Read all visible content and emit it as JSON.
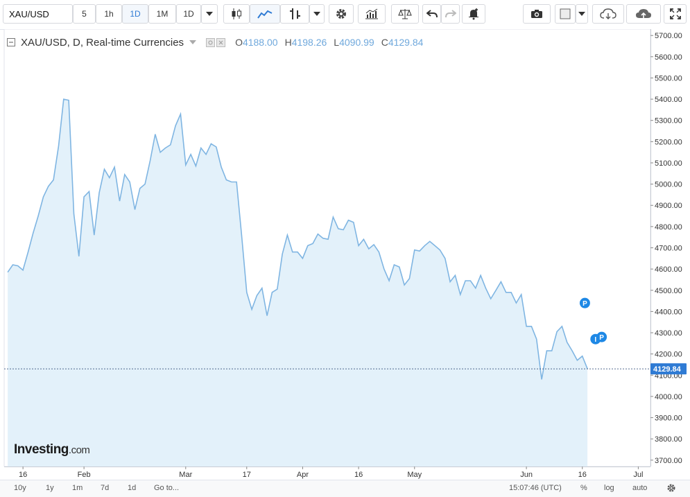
{
  "toolbar": {
    "symbol": "XAU/USD",
    "intervals": [
      "5",
      "1h",
      "1D",
      "1M",
      "1D"
    ],
    "active_interval_index": 2
  },
  "legend": {
    "title": "XAU/USD, D, Real-time Currencies",
    "o_label": "O",
    "o_value": "4188.00",
    "h_label": "H",
    "h_value": "4198.26",
    "l_label": "L",
    "l_value": "4090.99",
    "c_label": "C",
    "c_value": "4129.84"
  },
  "branding": {
    "name": "Investing",
    "domain": ".com"
  },
  "bottom_bar": {
    "ranges": [
      "10y",
      "1y",
      "1m",
      "7d",
      "1d"
    ],
    "goto": "Go to...",
    "time": "15:07:46 (UTC)",
    "percent": "%",
    "log": "log",
    "auto": "auto"
  },
  "colors": {
    "line": "#7fb5e2",
    "fill": "#e3f1fa",
    "price_tag": "#2f7bd4",
    "marker": "#1e88e5"
  },
  "chart_data": {
    "type": "area",
    "title": "XAU/USD, D, Real-time Currencies",
    "current_price": "4129.84",
    "y_ticks": [
      "3700.00",
      "3800.00",
      "3900.00",
      "4000.00",
      "4100.00",
      "4200.00",
      "4300.00",
      "4400.00",
      "4500.00",
      "4600.00",
      "4700.00",
      "4800.00",
      "4900.00",
      "5000.00",
      "5100.00",
      "5200.00",
      "5300.00",
      "5400.00",
      "5500.00",
      "5600.00",
      "5700.00"
    ],
    "ylim": [
      3670,
      5730
    ],
    "x_ticks": [
      {
        "label": "16",
        "t": 3
      },
      {
        "label": "Feb",
        "t": 15
      },
      {
        "label": "Mar",
        "t": 35
      },
      {
        "label": "17",
        "t": 47
      },
      {
        "label": "Apr",
        "t": 58
      },
      {
        "label": "16",
        "t": 69
      },
      {
        "label": "May",
        "t": 80
      },
      {
        "label": "Jun",
        "t": 102
      },
      {
        "label": "16",
        "t": 113
      },
      {
        "label": "Jul",
        "t": 124
      }
    ],
    "xlim": [
      -0.7,
      126.4
    ],
    "markers": [
      {
        "label": "P",
        "t": 113.5,
        "y": 4440
      },
      {
        "label": "I",
        "t": 115.6,
        "y": 4270
      },
      {
        "label": "P",
        "t": 116.8,
        "y": 4280
      }
    ],
    "series": [
      {
        "values": [
          4585,
          4620,
          4615,
          4595,
          4680,
          4770,
          4850,
          4940,
          4990,
          5020,
          5180,
          5400,
          5395,
          4860,
          4660,
          4940,
          4965,
          4760,
          4960,
          5070,
          5030,
          5080,
          4920,
          5045,
          5010,
          4880,
          4980,
          5000,
          5110,
          5235,
          5150,
          5170,
          5185,
          5275,
          5330,
          5090,
          5140,
          5085,
          5170,
          5140,
          5190,
          5175,
          5080,
          5020,
          5010,
          5010,
          4760,
          4490,
          4410,
          4475,
          4510,
          4380,
          4490,
          4505,
          4670,
          4760,
          4680,
          4680,
          4650,
          4710,
          4720,
          4765,
          4745,
          4740,
          4845,
          4790,
          4785,
          4830,
          4820,
          4710,
          4740,
          4695,
          4715,
          4680,
          4600,
          4545,
          4620,
          4610,
          4525,
          4555,
          4690,
          4685,
          4710,
          4730,
          4710,
          4690,
          4650,
          4540,
          4570,
          4480,
          4545,
          4545,
          4510,
          4570,
          4510,
          4460,
          4500,
          4540,
          4490,
          4490,
          4440,
          4480,
          4330,
          4330,
          4270,
          4080,
          4215,
          4215,
          4305,
          4330,
          4255,
          4215,
          4170,
          4190,
          4130
        ]
      }
    ]
  }
}
